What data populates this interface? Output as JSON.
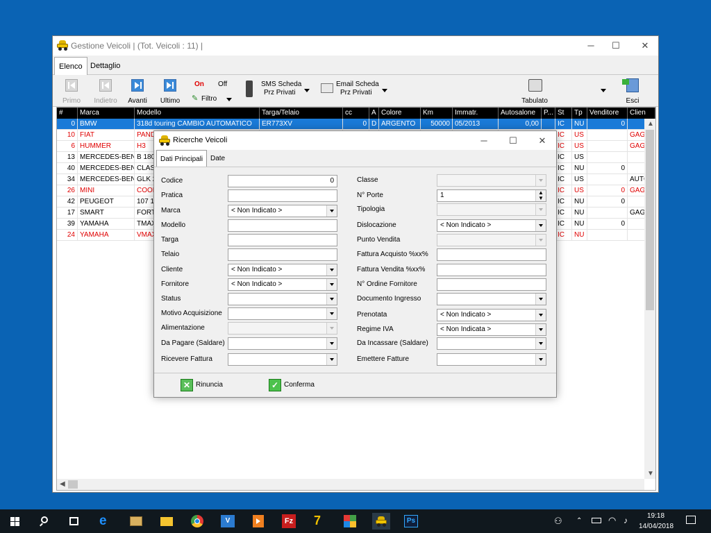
{
  "window": {
    "title": "Gestione Veicoli | (Tot. Veicoli : 11) |",
    "minimize": "─",
    "maximize": "☐",
    "close": "✕"
  },
  "tabs": [
    "Elenco",
    "Dettaglio"
  ],
  "toolbar": {
    "primo": "Primo",
    "indietro": "Indietro",
    "avanti": "Avanti",
    "ultimo": "Ultimo",
    "on": "On",
    "off": "Off",
    "filtro": "Filtro",
    "sms_line1": "SMS Scheda",
    "sms_line2": "Prz Privati",
    "email_line1": "Email Scheda",
    "email_line2": "Prz Privati",
    "tabulato": "Tabulato",
    "esci": "Esci"
  },
  "grid": {
    "columns": [
      "#",
      "Marca",
      "Modello",
      "Targa/Telaio",
      "cc",
      "A",
      "Colore",
      "Km",
      "Immatr.",
      "Autosalone",
      "P...",
      "St",
      "Tp",
      "Venditore",
      "Clien"
    ],
    "rows": [
      {
        "n": "0",
        "marca": "BMW",
        "modello": "318d touring CAMBIO AUTOMATICO",
        "targa": "ER773XV",
        "cc": "0",
        "a": "D",
        "colore": "ARGENTO",
        "km": "50000",
        "immatr": "05/2013",
        "autosalone": "0,00",
        "p": "",
        "st": "IC",
        "tp": "NU",
        "venditore": "0",
        "cliente": ""
      },
      {
        "n": "10",
        "marca": "FIAT",
        "modello": "PAND",
        "targa": "",
        "cc": "",
        "a": "",
        "colore": "",
        "km": "",
        "immatr": "",
        "autosalone": "",
        "p": "",
        "st": "IC",
        "tp": "US",
        "venditore": "",
        "cliente": "GAGG"
      },
      {
        "n": "6",
        "marca": "HUMMER",
        "modello": "H3",
        "targa": "",
        "cc": "",
        "a": "",
        "colore": "",
        "km": "",
        "immatr": "",
        "autosalone": "",
        "p": "",
        "st": "IC",
        "tp": "US",
        "venditore": "",
        "cliente": "GAGG"
      },
      {
        "n": "13",
        "marca": "MERCEDES-BENZ",
        "modello": "B 180",
        "targa": "",
        "cc": "",
        "a": "",
        "colore": "",
        "km": "",
        "immatr": "",
        "autosalone": "",
        "p": "",
        "st": "IC",
        "tp": "US",
        "venditore": "",
        "cliente": ""
      },
      {
        "n": "40",
        "marca": "MERCEDES-BENZ",
        "modello": "CLAS",
        "targa": "",
        "cc": "",
        "a": "",
        "colore": "",
        "km": "",
        "immatr": "",
        "autosalone": "",
        "p": "",
        "st": "IC",
        "tp": "NU",
        "venditore": "0",
        "cliente": ""
      },
      {
        "n": "34",
        "marca": "MERCEDES-BENZ",
        "modello": "GLK 2",
        "targa": "",
        "cc": "",
        "a": "",
        "colore": "",
        "km": "",
        "immatr": "",
        "autosalone": "",
        "p": "",
        "st": "IC",
        "tp": "US",
        "venditore": "",
        "cliente": "AUTC"
      },
      {
        "n": "26",
        "marca": "MINI",
        "modello": "COOP",
        "targa": "",
        "cc": "",
        "a": "",
        "colore": "",
        "km": "",
        "immatr": "",
        "autosalone": "",
        "p": "",
        "st": "IC",
        "tp": "US",
        "venditore": "0",
        "cliente": "GAGG"
      },
      {
        "n": "42",
        "marca": "PEUGEOT",
        "modello": "107 1",
        "targa": "",
        "cc": "",
        "a": "",
        "colore": "",
        "km": "",
        "immatr": "",
        "autosalone": "",
        "p": "",
        "st": "IC",
        "tp": "NU",
        "venditore": "0",
        "cliente": ""
      },
      {
        "n": "17",
        "marca": "SMART",
        "modello": "FORT",
        "targa": "",
        "cc": "",
        "a": "",
        "colore": "",
        "km": "",
        "immatr": "",
        "autosalone": "",
        "p": "",
        "st": "IC",
        "tp": "NU",
        "venditore": "",
        "cliente": "GAGG"
      },
      {
        "n": "39",
        "marca": "YAMAHA",
        "modello": "TMAX",
        "targa": "",
        "cc": "",
        "a": "",
        "colore": "",
        "km": "",
        "immatr": "",
        "autosalone": "",
        "p": "",
        "st": "IC",
        "tp": "NU",
        "venditore": "0",
        "cliente": ""
      },
      {
        "n": "24",
        "marca": "YAMAHA",
        "modello": "VMAX",
        "targa": "",
        "cc": "",
        "a": "",
        "colore": "",
        "km": "",
        "immatr": "",
        "autosalone": "",
        "p": "",
        "st": "IC",
        "tp": "NU",
        "venditore": "",
        "cliente": ""
      }
    ]
  },
  "dialog": {
    "title": "Ricerche Veicoli",
    "minimize": "─",
    "maximize": "☐",
    "close": "✕",
    "tabs": [
      "Dati Principali",
      "Date"
    ],
    "left": [
      {
        "label": "Codice",
        "value": "0",
        "type": "text-right"
      },
      {
        "label": "Pratica",
        "value": "",
        "type": "text"
      },
      {
        "label": "Marca",
        "value": "< Non Indicato >",
        "type": "combo"
      },
      {
        "label": "Modello",
        "value": "",
        "type": "text"
      },
      {
        "label": "Targa",
        "value": "",
        "type": "text"
      },
      {
        "label": "Telaio",
        "value": "",
        "type": "text"
      },
      {
        "label": "Cliente",
        "value": "< Non Indicato >",
        "type": "combo"
      },
      {
        "label": "Fornitore",
        "value": "< Non Indicato >",
        "type": "combo"
      },
      {
        "label": "Status",
        "value": "",
        "type": "combo"
      },
      {
        "label": "Motivo Acquisizione",
        "value": "",
        "type": "combo"
      },
      {
        "label": "Alimentazione",
        "value": "",
        "type": "combo-dis"
      },
      {
        "label": "Da Pagare (Saldare)",
        "value": "",
        "type": "combo"
      },
      {
        "label": "Ricevere Fattura",
        "value": "",
        "type": "combo"
      }
    ],
    "right": [
      {
        "label": "Classe",
        "value": "",
        "type": "combo-dis"
      },
      {
        "label": "N° Porte",
        "value": "1",
        "type": "spin"
      },
      {
        "label": "Tipologia",
        "value": "",
        "type": "combo-dis"
      },
      {
        "label": "Dislocazione",
        "value": "< Non Indicato >",
        "type": "combo"
      },
      {
        "label": "Punto Vendita",
        "value": "",
        "type": "combo-dis"
      },
      {
        "label": "Fattura Acquisto %xx%",
        "value": "",
        "type": "text"
      },
      {
        "label": "Fattura Vendita %xx%",
        "value": "",
        "type": "text"
      },
      {
        "label": "N° Ordine Fornitore",
        "value": "",
        "type": "text"
      },
      {
        "label": "Documento Ingresso",
        "value": "",
        "type": "combo"
      },
      {
        "label": "Prenotata",
        "value": "< Non Indicato >",
        "type": "combo"
      },
      {
        "label": "Regime IVA",
        "value": "< Non Indicata >",
        "type": "combo"
      },
      {
        "label": "Da Incassare (Saldare)",
        "value": "",
        "type": "combo"
      },
      {
        "label": "Emettere Fatture",
        "value": "",
        "type": "combo"
      }
    ],
    "rinuncia": "Rinuncia",
    "conferma": "Conferma"
  },
  "taskbar": {
    "time": "19:18",
    "date": "14/04/2018",
    "icons": [
      "windows-start-icon",
      "search-icon",
      "task-view-icon",
      "edge-icon",
      "app-folder-icon",
      "file-explorer-icon",
      "chrome-icon",
      "vs-icon",
      "media-icon",
      "filezilla-icon",
      "7zip-icon",
      "puzzle-icon",
      "car-app-icon",
      "photoshop-icon"
    ]
  },
  "colors": {
    "desktop": "#0a63b4",
    "selection": "#1a7ad8",
    "red_row": "#e00000",
    "taskbar": "#10181e"
  }
}
